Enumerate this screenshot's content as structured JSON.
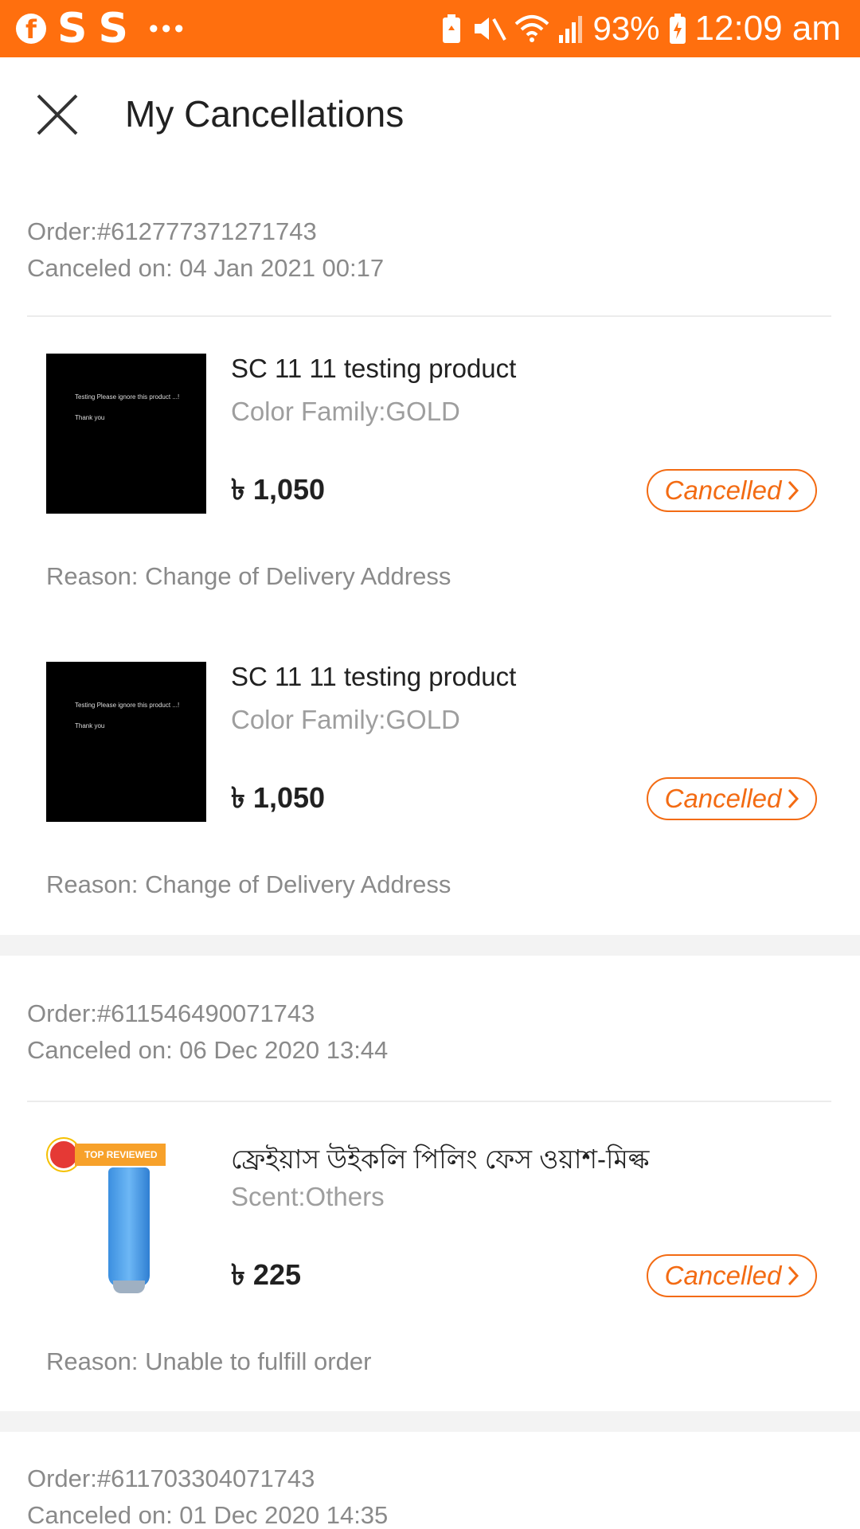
{
  "status_bar": {
    "left_icons": [
      "facebook-icon",
      "s-app-icon",
      "s-app-icon",
      "more-dots-icon"
    ],
    "s_letter": "S",
    "battery_percent": "93%",
    "time": "12:09 am"
  },
  "header": {
    "title": "My Cancellations",
    "close_icon": "close-icon"
  },
  "orders": [
    {
      "order_no": "Order:#612777371271743",
      "canceled_on": "Canceled on: 04 Jan 2021 00:17",
      "items": [
        {
          "name": "SC 11 11 testing product",
          "variant": "Color Family:GOLD",
          "price": "৳ 1,050",
          "status": "Cancelled",
          "reason": "Reason: Change of Delivery Address",
          "thumb": "black-test-image"
        },
        {
          "name": "SC 11 11 testing product",
          "variant": "Color Family:GOLD",
          "price": "৳ 1,050",
          "status": "Cancelled",
          "reason": "Reason: Change of Delivery Address",
          "thumb": "black-test-image"
        }
      ]
    },
    {
      "order_no": "Order:#611546490071743",
      "canceled_on": "Canceled on: 06 Dec 2020 13:44",
      "items": [
        {
          "name": "ফ্রেইয়াস উইকলি পিলিং ফেস ওয়াশ-মিল্ক",
          "variant": "Scent:Others",
          "price": "৳ 225",
          "status": "Cancelled",
          "reason": "Reason: Unable to fulfill order",
          "thumb": "face-wash-image",
          "badge": "TOP REVIEWED"
        }
      ]
    },
    {
      "order_no": "Order:#611703304071743",
      "canceled_on": "Canceled on: 01 Dec 2020 14:35"
    }
  ],
  "colors": {
    "status_bar": "#ff6f0e",
    "accent": "#f36b13",
    "muted_text": "#8a8a8a",
    "section_gap": "#f3f3f3"
  }
}
